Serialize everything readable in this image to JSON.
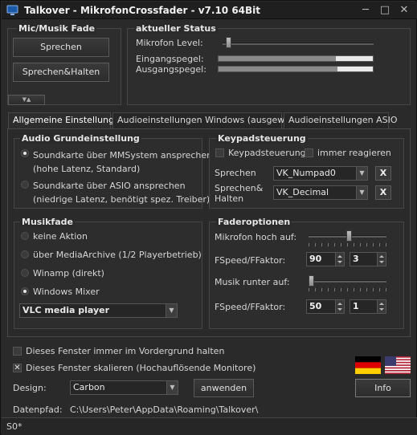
{
  "window": {
    "title": "Talkover - MikrofonCrossfader  - v7.10 64Bit",
    "minimize": "─",
    "maximize": "□",
    "close": "✕"
  },
  "mic_music": {
    "title": "Mic/Musik Fade",
    "speak": "Sprechen",
    "speak_hold": "Sprechen&Halten",
    "collapse_glyph": "▼▲"
  },
  "status": {
    "title": "aktueller Status",
    "mic_level_label": "Mikrofon Level:",
    "mic_level": 0.02,
    "input_label": "Eingangspegel:",
    "input_level": 0.76,
    "output_label": "Ausgangspegel:",
    "output_level": 0.77
  },
  "tabs": [
    {
      "label": "Allgemeine Einstellungen"
    },
    {
      "label": "Audioeinstellungen Windows (ausgewählt)"
    },
    {
      "label": "Audioeinstellungen ASIO"
    }
  ],
  "audio": {
    "title": "Audio Grundeinstellung",
    "opt1_line1": "Soundkarte über MMSystem ansprechen",
    "opt1_line2": "(hohe Latenz, Standard)",
    "opt2_line1": "Soundkarte über ASIO ansprechen",
    "opt2_line2": "(niedrige Latenz, benötigt spez. Treiber)"
  },
  "keypad": {
    "title": "Keypadsteuerung",
    "enable_label": "Keypadsteuerung",
    "always_label": "immer reagieren",
    "speak_label": "Sprechen",
    "speak_value": "VK_Numpad0",
    "hold_label_1": "Sprechen&",
    "hold_label_2": "Halten",
    "hold_value": "VK_Decimal",
    "clear": "X"
  },
  "music": {
    "title": "Musikfade",
    "options": [
      "keine Aktion",
      "über MediaArchive (1/2 Playerbetrieb)",
      "Winamp (direkt)",
      "Windows Mixer"
    ],
    "player": "VLC media player"
  },
  "fader": {
    "title": "Faderoptionen",
    "mic_up_label": "Mikrofon hoch auf:",
    "mic_up_level": 0.52,
    "speed1_label": "FSpeed/FFaktor:",
    "speed1": "90",
    "factor1": "3",
    "music_down_label": "Musik runter auf:",
    "music_down_level": 0.0,
    "speed2_label": "FSpeed/FFaktor:",
    "speed2": "50",
    "factor2": "1"
  },
  "options": {
    "foreground": "Dieses Fenster immer im Vordergrund halten",
    "scale": "Dieses Fenster skalieren (Hochauflösende Monitore)",
    "design_label": "Design:",
    "design_value": "Carbon",
    "apply": "anwenden",
    "info": "Info",
    "path_label": "Datenpfad:",
    "path_value": "C:\\Users\\Peter\\AppData\\Roaming\\Talkover\\"
  },
  "statusbar": {
    "text": "S0*"
  }
}
